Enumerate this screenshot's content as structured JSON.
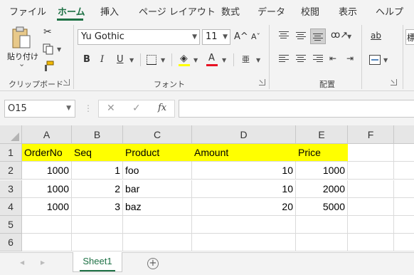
{
  "ribbon_tabs": [
    "ファイル",
    "ホーム",
    "挿入",
    "ページ レイアウト",
    "数式",
    "データ",
    "校閲",
    "表示",
    "ヘルプ"
  ],
  "active_tab": "ホーム",
  "clipboard": {
    "paste_label": "貼り付け",
    "paste_caret": "⌄",
    "group_label": "クリップボード"
  },
  "font": {
    "name": "Yu Gothic",
    "size": "11",
    "grow": "A^",
    "shrink": "Aˇ",
    "bold": "B",
    "italic": "I",
    "underline": "U",
    "font_color_glyph": "A",
    "phonetic_glyph": "亜",
    "group_label": "フォント",
    "fill_color": "#ffff00",
    "font_color": "#e81123"
  },
  "alignment": {
    "wrap_glyph": "ab",
    "group_label": "配置"
  },
  "right_edge_text": "標",
  "formula_bar": {
    "name_box": "O15",
    "cancel": "✕",
    "enter": "✓",
    "fx": "fx",
    "formula": ""
  },
  "sheet": {
    "column_headers": [
      "A",
      "B",
      "C",
      "D",
      "E",
      "F"
    ],
    "row_headers": [
      "1",
      "2",
      "3",
      "4",
      "5",
      "6"
    ],
    "header_row": [
      "OrderNo",
      "Seq",
      "Product",
      "Amount",
      "Price"
    ],
    "rows": [
      [
        "1000",
        "1",
        "foo",
        "10",
        "1000"
      ],
      [
        "1000",
        "2",
        "bar",
        "10",
        "2000"
      ],
      [
        "1000",
        "3",
        "baz",
        "20",
        "5000"
      ]
    ],
    "highlight_color": "#ffff00"
  },
  "sheet_tabs": {
    "active": "Sheet1",
    "add_glyph": "+",
    "nav_prev": "◀",
    "nav_next": "▶"
  }
}
